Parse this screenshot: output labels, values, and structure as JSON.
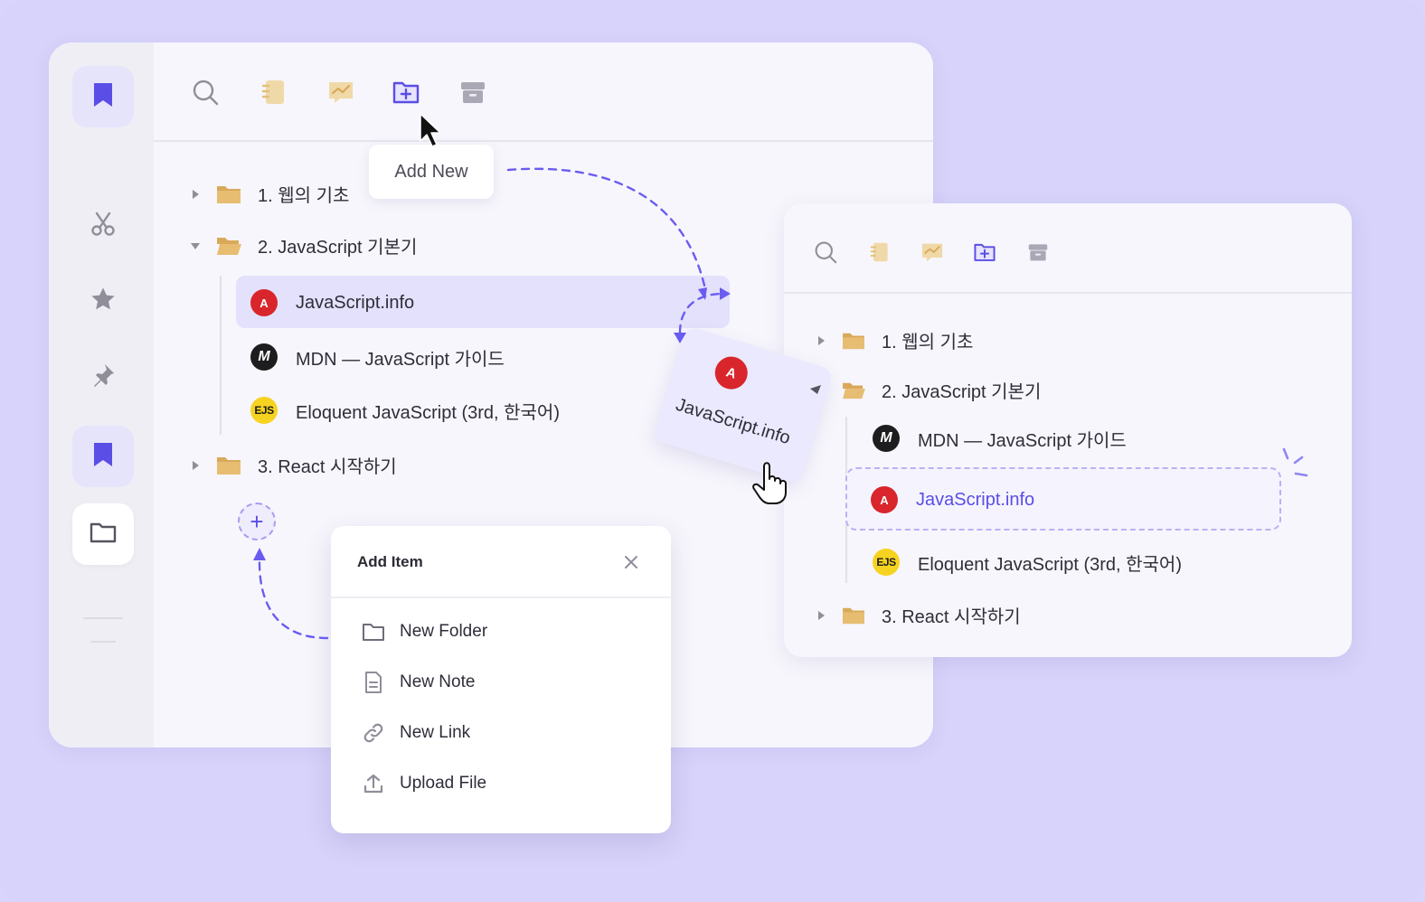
{
  "main_window": {
    "rail": {
      "items": [
        "bookmark-icon",
        "scissors-icon",
        "star-icon",
        "pin-icon",
        "bookmark-icon",
        "folder-icon"
      ]
    },
    "toolbar": {
      "icons": [
        "search-icon",
        "notes-icon",
        "chart-icon",
        "add-folder-icon",
        "archive-icon"
      ],
      "tooltip": "Add New"
    },
    "tree": [
      {
        "label": "1. 웹의 기초",
        "type": "folder",
        "expanded": false
      },
      {
        "label": "2. JavaScript 기본기",
        "type": "folder",
        "expanded": true
      },
      {
        "label": "JavaScript.info",
        "type": "link",
        "icon": "A",
        "highlighted": true
      },
      {
        "label": "MDN — JavaScript 가이드",
        "type": "link",
        "icon": "M"
      },
      {
        "label": "Eloquent JavaScript (3rd, 한국어)",
        "type": "link",
        "icon": "EJS"
      },
      {
        "label": "3. React 시작하기",
        "type": "folder",
        "expanded": false
      }
    ],
    "add_button": "+"
  },
  "add_item_popup": {
    "title": "Add Item",
    "items": [
      {
        "label": "New Folder",
        "icon": "folder-outline-icon"
      },
      {
        "label": "New Note",
        "icon": "note-icon"
      },
      {
        "label": "New Link",
        "icon": "link-icon"
      },
      {
        "label": "Upload File",
        "icon": "upload-icon"
      }
    ]
  },
  "drag_ghost": {
    "label": "JavaScript.info",
    "icon": "A"
  },
  "second_window": {
    "toolbar": {
      "icons": [
        "search-icon",
        "notes-icon",
        "chart-icon",
        "add-folder-icon",
        "archive-icon"
      ]
    },
    "tree": [
      {
        "label": "1. 웹의 기초",
        "type": "folder",
        "expanded": false
      },
      {
        "label": "2. JavaScript 기본기",
        "type": "folder",
        "expanded": true
      },
      {
        "label": "MDN — JavaScript 가이드",
        "type": "link",
        "icon": "M"
      },
      {
        "label": "JavaScript.info",
        "type": "link",
        "icon": "A",
        "dropped": true
      },
      {
        "label": "Eloquent JavaScript (3rd, 한국어)",
        "type": "link",
        "icon": "EJS"
      },
      {
        "label": "3. React 시작하기",
        "type": "folder",
        "expanded": false
      }
    ]
  },
  "colors": {
    "background": "#d8d4fb",
    "accent": "#5a4ee6",
    "folder": "#d9a95a",
    "highlight": "#e3e1fb"
  }
}
